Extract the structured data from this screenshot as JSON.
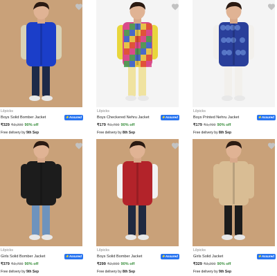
{
  "products": [
    {
      "brand": "Lilpicks",
      "title": "Boys Solid Bomber Jacket",
      "price": "₹329",
      "mrp": "₹3,299",
      "discount": "90% off",
      "delivery_prefix": "Free delivery by",
      "delivery_date": "9th Sep",
      "assured_label": "Assured",
      "wishlist_icon": "heart-icon",
      "colors": {
        "bg": "#c9a179",
        "primary": "#1b3ec9",
        "secondary": "#d8d2b6",
        "pants": "#1d2a48"
      }
    },
    {
      "brand": "Lilpicks",
      "title": "Boys Checkered Nehru Jacket",
      "price": "₹179",
      "mrp": "₹1,799",
      "discount": "90% off",
      "delivery_prefix": "Free delivery by",
      "delivery_date": "8th Sep",
      "assured_label": "Assured",
      "wishlist_icon": "heart-icon",
      "colors": {
        "bg": "#f4f4f4",
        "primary": "#d94a8a",
        "secondary": "#e8d63c",
        "pants": "#f0e3a0"
      }
    },
    {
      "brand": "Lilpicks",
      "title": "Boys Printed Nehru Jacket",
      "price": "₹179",
      "mrp": "₹1,799",
      "discount": "90% off",
      "delivery_prefix": "Free delivery by",
      "delivery_date": "8th Sep",
      "assured_label": "Assured",
      "wishlist_icon": "heart-icon",
      "colors": {
        "bg": "#f4f4f4",
        "primary": "#2a3f9a",
        "secondary": "#f2f0ec",
        "pants": "#f2f0ec"
      }
    },
    {
      "brand": "Lilpicks",
      "title": "Girls Solid Bomber Jacket",
      "price": "₹379",
      "mrp": "₹3,799",
      "discount": "90% off",
      "delivery_prefix": "Free delivery by",
      "delivery_date": "9th Sep",
      "assured_label": "Assured",
      "wishlist_icon": "heart-icon",
      "colors": {
        "bg": "#c9a179",
        "primary": "#1c1c1c",
        "secondary": "#1c1c1c",
        "pants": "#6e93bd"
      }
    },
    {
      "brand": "Lilpicks",
      "title": "Boys Solid Bomber Jacket",
      "price": "₹299",
      "mrp": "₹2,999",
      "discount": "90% off",
      "delivery_prefix": "Free delivery by",
      "delivery_date": "8th Sep",
      "assured_label": "Assured",
      "wishlist_icon": "heart-icon",
      "colors": {
        "bg": "#c9a179",
        "primary": "#b3232a",
        "secondary": "#f2f2f2",
        "pants": "#1f2940"
      }
    },
    {
      "brand": "Lilpicks",
      "title": "Girls Solid Jacket",
      "price": "₹329",
      "mrp": "₹3,299",
      "discount": "90% off",
      "delivery_prefix": "Free delivery by",
      "delivery_date": "9th Sep",
      "assured_label": "Assured",
      "wishlist_icon": "heart-icon",
      "colors": {
        "bg": "#c9a179",
        "primary": "#d9bd94",
        "secondary": "#d9bd94",
        "pants": "#1c1c1c"
      }
    }
  ]
}
